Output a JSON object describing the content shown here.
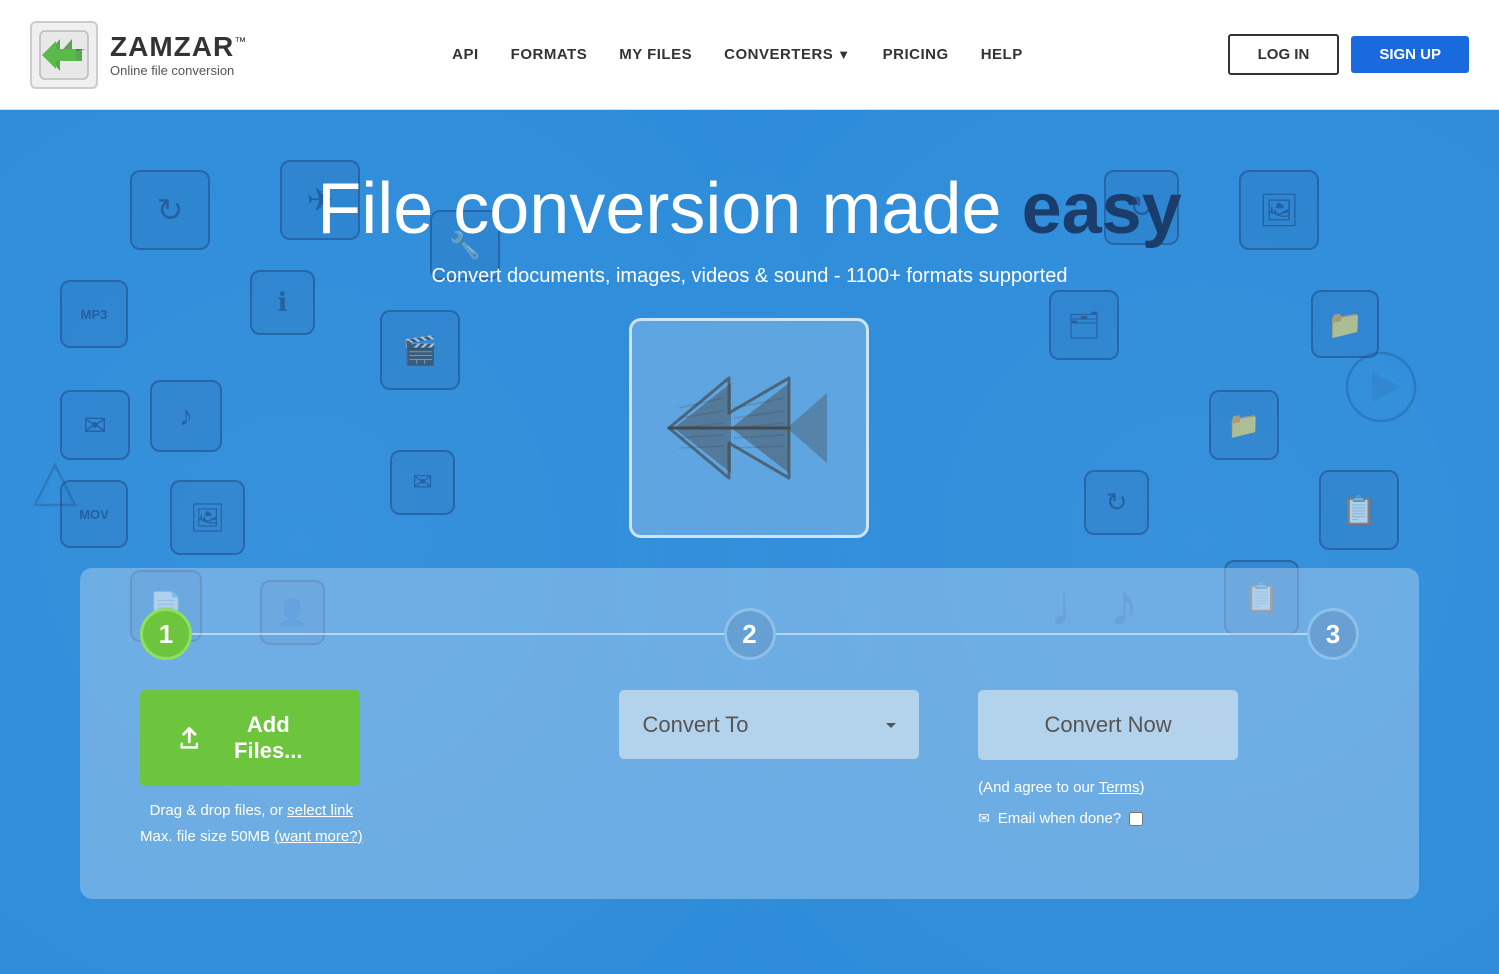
{
  "header": {
    "logo_name": "ZAMZAR",
    "logo_tm": "™",
    "logo_tagline": "Online file conversion",
    "nav": {
      "api": "API",
      "formats": "FORMATS",
      "my_files": "MY FILES",
      "converters": "CONVERTERS",
      "pricing": "PRICING",
      "help": "HELP"
    },
    "login_label": "LOG IN",
    "signup_label": "SIGN UP"
  },
  "hero": {
    "title_plain": "File ",
    "title_highlight": "conversion",
    "title_end": " made ",
    "title_strong": "easy",
    "subtitle": "Convert documents, images, videos & sound - 1100+ formats supported"
  },
  "converter": {
    "step1_num": "1",
    "step2_num": "2",
    "step3_num": "3",
    "add_files_label": "Add Files...",
    "drag_drop_text": "Drag & drop files, or ",
    "select_link_text": "select link",
    "max_size_text": "Max. file size 50MB ",
    "want_more_text": "(want more?)",
    "convert_to_placeholder": "Convert To",
    "convert_now_label": "Convert Now",
    "agree_text": "(And agree to our ",
    "terms_text": "Terms",
    "agree_end": ")",
    "email_label": "Email when done?",
    "convert_to_dropdown_icon": "▼"
  }
}
